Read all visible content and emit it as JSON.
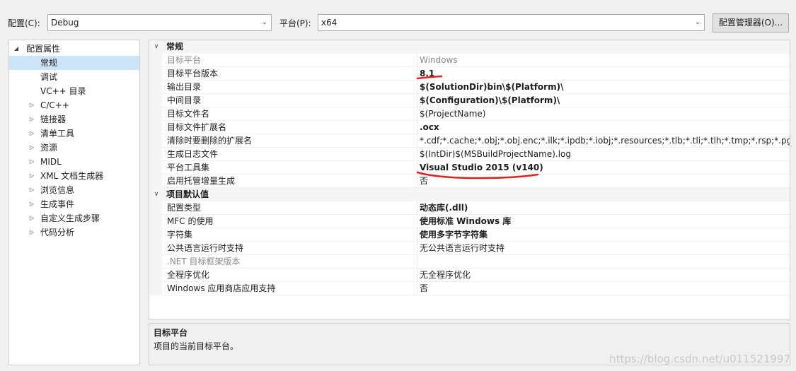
{
  "toolbar": {
    "config_label": "配置(C):",
    "config_value": "Debug",
    "platform_label": "平台(P):",
    "platform_value": "x64",
    "config_manager_label": "配置管理器(O)..."
  },
  "tree": {
    "root": "配置属性",
    "items": [
      {
        "label": "常规",
        "expandable": false,
        "selected": true
      },
      {
        "label": "调试",
        "expandable": false
      },
      {
        "label": "VC++ 目录",
        "expandable": false
      },
      {
        "label": "C/C++",
        "expandable": true
      },
      {
        "label": "链接器",
        "expandable": true
      },
      {
        "label": "清单工具",
        "expandable": true
      },
      {
        "label": "资源",
        "expandable": true
      },
      {
        "label": "MIDL",
        "expandable": true
      },
      {
        "label": "XML 文档生成器",
        "expandable": true
      },
      {
        "label": "浏览信息",
        "expandable": true
      },
      {
        "label": "生成事件",
        "expandable": true
      },
      {
        "label": "自定义生成步骤",
        "expandable": true
      },
      {
        "label": "代码分析",
        "expandable": true
      }
    ]
  },
  "grid": {
    "categories": [
      {
        "title": "常规",
        "rows": [
          {
            "key": "目标平台",
            "value": "Windows",
            "disabled": true
          },
          {
            "key": "目标平台版本",
            "value": "8.1",
            "bold": true
          },
          {
            "key": "输出目录",
            "value": "$(SolutionDir)bin\\$(Platform)\\",
            "bold": true
          },
          {
            "key": "中间目录",
            "value": "$(Configuration)\\$(Platform)\\",
            "bold": true
          },
          {
            "key": "目标文件名",
            "value": "$(ProjectName)"
          },
          {
            "key": "目标文件扩展名",
            "value": ".ocx",
            "bold": true
          },
          {
            "key": "清除时要删除的扩展名",
            "value": "*.cdf;*.cache;*.obj;*.obj.enc;*.ilk;*.ipdb;*.iobj;*.resources;*.tlb;*.tli;*.tlh;*.tmp;*.rsp;*.pgc;*.pgd;"
          },
          {
            "key": "生成日志文件",
            "value": "$(IntDir)$(MSBuildProjectName).log"
          },
          {
            "key": "平台工具集",
            "value": "Visual Studio 2015 (v140)",
            "bold": true
          },
          {
            "key": "启用托管增量生成",
            "value": "否"
          }
        ]
      },
      {
        "title": "项目默认值",
        "rows": [
          {
            "key": "配置类型",
            "value": "动态库(.dll)",
            "bold": true
          },
          {
            "key": "MFC 的使用",
            "value": "使用标准 Windows 库",
            "bold": true
          },
          {
            "key": "字符集",
            "value": "使用多字节字符集",
            "bold": true
          },
          {
            "key": "公共语言运行时支持",
            "value": "无公共语言运行时支持"
          },
          {
            "key": ".NET 目标框架版本",
            "value": "",
            "disabled": true
          },
          {
            "key": "全程序优化",
            "value": "无全程序优化"
          },
          {
            "key": "Windows 应用商店应用支持",
            "value": "否"
          }
        ]
      }
    ]
  },
  "description": {
    "title": "目标平台",
    "body": "项目的当前目标平台。"
  },
  "watermark": "https://blog.csdn.net/u011521997",
  "colors": {
    "selected_bg": "#cce4f7",
    "annotation_red": "#e02020"
  }
}
